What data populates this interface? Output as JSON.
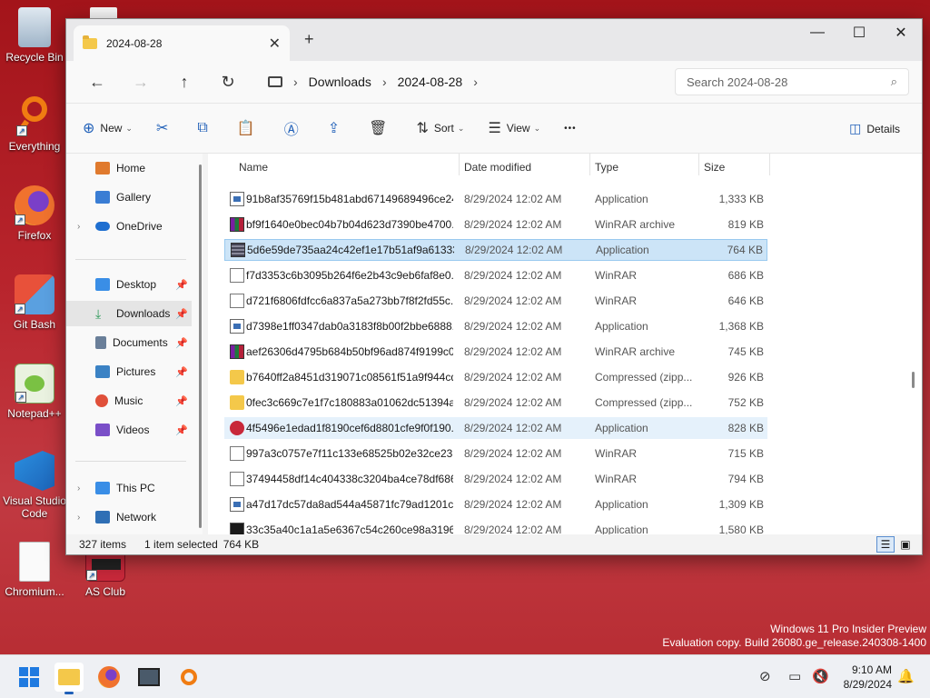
{
  "desktop": {
    "icons": [
      {
        "label": "Recycle Bin"
      },
      {
        "label": "Everything"
      },
      {
        "label": "Firefox"
      },
      {
        "label": "Git Bash"
      },
      {
        "label": "Notepad++"
      },
      {
        "label": "Visual Studio Code"
      },
      {
        "label": "Chromium..."
      },
      {
        "label": "AS Club"
      }
    ],
    "watermark_line1": "Windows 11 Pro Insider Preview",
    "watermark_line2": "Evaluation copy. Build 26080.ge_release.240308-1400"
  },
  "window": {
    "tab_title": "2024-08-28",
    "tab_close": "✕",
    "new_tab": "+",
    "controls": {
      "minimize": "—",
      "maximize": "☐",
      "close": "✕"
    }
  },
  "navbar": {
    "back": "←",
    "forward": "→",
    "up": "↑",
    "refresh": "↻",
    "crumbs": [
      "Downloads",
      "2024-08-28"
    ],
    "search_placeholder": "Search 2024-08-28"
  },
  "commandbar": {
    "new_label": "New",
    "sort_label": "Sort",
    "view_label": "View",
    "more_label": "•••",
    "details_label": "Details"
  },
  "sidebar": {
    "items": [
      {
        "label": "Home",
        "color": "#e07a2e"
      },
      {
        "label": "Gallery",
        "color": "#3a7dd4"
      },
      {
        "label": "OneDrive",
        "color": "#1f6fd0"
      },
      {
        "label": "Desktop",
        "color": "#3a8ee6"
      },
      {
        "label": "Downloads",
        "color": "#2e9a5a"
      },
      {
        "label": "Documents",
        "color": "#6a7f99"
      },
      {
        "label": "Pictures",
        "color": "#3b82c4"
      },
      {
        "label": "Music",
        "color": "#e0503a"
      },
      {
        "label": "Videos",
        "color": "#7a4fc8"
      },
      {
        "label": "This PC",
        "color": "#3a8ee6"
      },
      {
        "label": "Network",
        "color": "#2f6fb5"
      }
    ]
  },
  "columns": {
    "name": "Name",
    "date": "Date modified",
    "type": "Type",
    "size": "Size"
  },
  "files": [
    {
      "name": "91b8af35769f15b481abd67149689496ce24...",
      "date": "8/29/2024 12:02 AM",
      "type": "Application",
      "size": "1,333 KB",
      "icon": "app"
    },
    {
      "name": "bf9f1640e0bec04b7b04d623d7390be4700...",
      "date": "8/29/2024 12:02 AM",
      "type": "WinRAR archive",
      "size": "819 KB",
      "icon": "rar"
    },
    {
      "name": "5d6e59de735aa24c42ef1e17b51af9a61333...",
      "date": "8/29/2024 12:02 AM",
      "type": "Application",
      "size": "764 KB",
      "icon": "grid"
    },
    {
      "name": "f7d3353c6b3095b264f6e2b43c9eb6faf8e0...",
      "date": "8/29/2024 12:02 AM",
      "type": "WinRAR",
      "size": "686 KB",
      "icon": "blank"
    },
    {
      "name": "d721f6806fdfcc6a837a5a273bb7f8f2fd55c...",
      "date": "8/29/2024 12:02 AM",
      "type": "WinRAR",
      "size": "646 KB",
      "icon": "blank"
    },
    {
      "name": "d7398e1ff0347dab0a3183f8b00f2bbe6888...",
      "date": "8/29/2024 12:02 AM",
      "type": "Application",
      "size": "1,368 KB",
      "icon": "app"
    },
    {
      "name": "aef26306d4795b684b50bf96ad874f9199c0...",
      "date": "8/29/2024 12:02 AM",
      "type": "WinRAR archive",
      "size": "745 KB",
      "icon": "rar"
    },
    {
      "name": "b7640ff2a8451d319071c08561f51a9f944cd...",
      "date": "8/29/2024 12:02 AM",
      "type": "Compressed (zipp...",
      "size": "926 KB",
      "icon": "zip"
    },
    {
      "name": "0fec3c669c7e1f7c180883a01062dc51394a...",
      "date": "8/29/2024 12:02 AM",
      "type": "Compressed (zipp...",
      "size": "752 KB",
      "icon": "zip"
    },
    {
      "name": "4f5496e1edad1f8190cef6d8801cfe9f0f190...",
      "date": "8/29/2024 12:02 AM",
      "type": "Application",
      "size": "828 KB",
      "icon": "red"
    },
    {
      "name": "997a3c0757e7f11c133e68525b02e32ce235...",
      "date": "8/29/2024 12:02 AM",
      "type": "WinRAR",
      "size": "715 KB",
      "icon": "blank"
    },
    {
      "name": "37494458df14c404338c3204ba4ce78df686...",
      "date": "8/29/2024 12:02 AM",
      "type": "WinRAR",
      "size": "794 KB",
      "icon": "blank"
    },
    {
      "name": "a47d17dc57da8ad544a45871fc79ad1201c...",
      "date": "8/29/2024 12:02 AM",
      "type": "Application",
      "size": "1,309 KB",
      "icon": "app"
    },
    {
      "name": "33c35a40c1a1a5e6367c54c260ce98a31965...",
      "date": "8/29/2024 12:02 AM",
      "type": "Application",
      "size": "1,580 KB",
      "icon": "dark"
    }
  ],
  "status": {
    "count": "327 items",
    "selected": "1 item selected",
    "size": "764 KB"
  },
  "taskbar": {
    "time": "9:10 AM",
    "date": "8/29/2024"
  }
}
